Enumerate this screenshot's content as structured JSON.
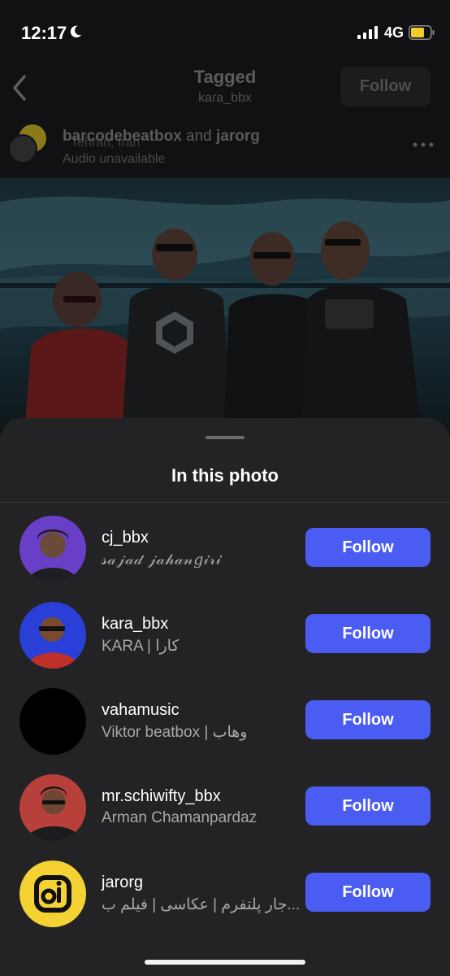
{
  "status_bar": {
    "time": "12:17",
    "network": "4G"
  },
  "header": {
    "title": "Tagged",
    "subtitle": "kara_bbx",
    "follow_label": "Follow"
  },
  "post": {
    "user_a": "barcodebeatbox",
    "joiner": " and ",
    "user_b": "jarorg",
    "location": "Tehran, Iran",
    "audio": "Audio unavailable"
  },
  "sheet": {
    "title": "In this photo",
    "people": [
      {
        "username": "cj_bbx",
        "full_name": "𝓈𝒶𝒿𝒶𝒹 𝒿𝒶𝒽𝒶𝓃𝑔𝒾𝓇𝒾",
        "follow_label": "Follow",
        "avatar_color": "#6a3fc8"
      },
      {
        "username": "kara_bbx",
        "full_name": "KARA | کارا",
        "follow_label": "Follow",
        "avatar_color": "#2a3fd8"
      },
      {
        "username": "vahamusic",
        "full_name": "Viktor beatbox | وهاب",
        "follow_label": "Follow",
        "avatar_color": "#000000"
      },
      {
        "username": "mr.schiwifty_bbx",
        "full_name": "Arman Chamanpardaz",
        "follow_label": "Follow",
        "avatar_color": "#c0433a"
      },
      {
        "username": "jarorg",
        "full_name": "جار پلتفرم | عکاسی | فیلم ب...",
        "follow_label": "Follow",
        "avatar_color": "#f5d233"
      }
    ]
  },
  "colors": {
    "accent": "#4a5cf2",
    "sheet_bg": "#232326",
    "page_bg": "#111113"
  }
}
